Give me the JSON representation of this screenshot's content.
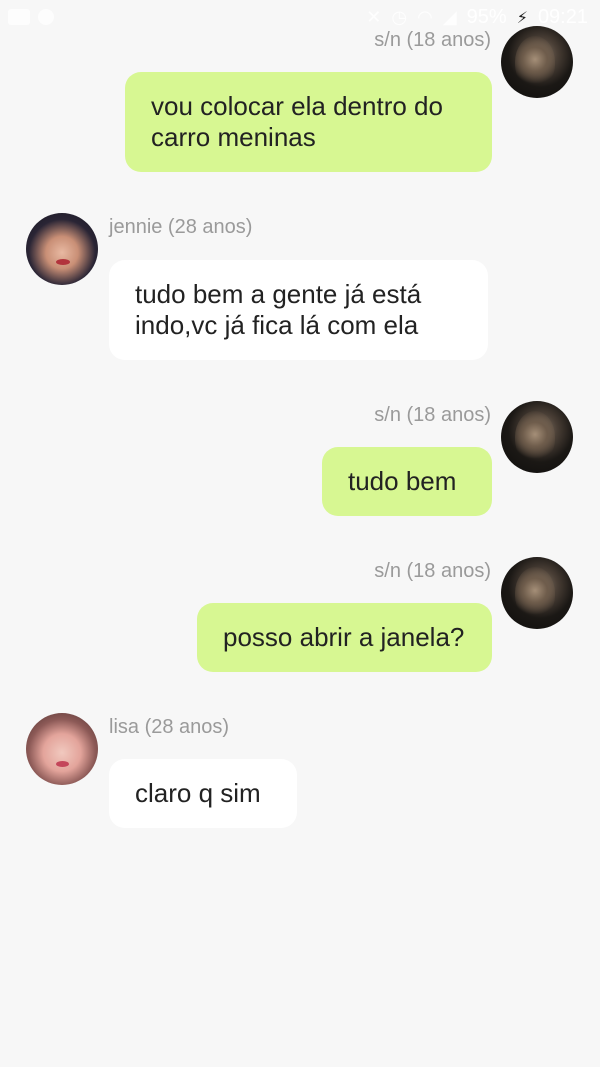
{
  "status_bar": {
    "battery": "95%",
    "time": "09:21",
    "left_icons": [
      "camera-icon",
      "person-icon"
    ],
    "right_icons": [
      "wifi-off-icon",
      "alarm-icon",
      "wifi-icon",
      "signal-icon",
      "charging-icon"
    ]
  },
  "messages": [
    {
      "sender": "s/n (18 anos)",
      "side": "right",
      "avatar": "avatar-sn",
      "text": "vou colocar ela dentro do carro meninas"
    },
    {
      "sender": "jennie (28 anos)",
      "side": "left",
      "avatar": "avatar-jennie",
      "text": "tudo bem a gente já está indo,vc já fica lá com ela"
    },
    {
      "sender": "s/n (18 anos)",
      "side": "right",
      "avatar": "avatar-sn",
      "text": "tudo bem"
    },
    {
      "sender": "s/n (18 anos)",
      "side": "right",
      "avatar": "avatar-sn",
      "text": "posso abrir a janela?"
    },
    {
      "sender": "lisa (28 anos)",
      "side": "left",
      "avatar": "avatar-lisa",
      "text": "claro q sim"
    }
  ],
  "colors": {
    "background": "#f7f7f7",
    "outgoing_bubble": "#d7f792",
    "incoming_bubble": "#ffffff",
    "sender_name": "#9a9a9a",
    "message_text": "#222222"
  }
}
